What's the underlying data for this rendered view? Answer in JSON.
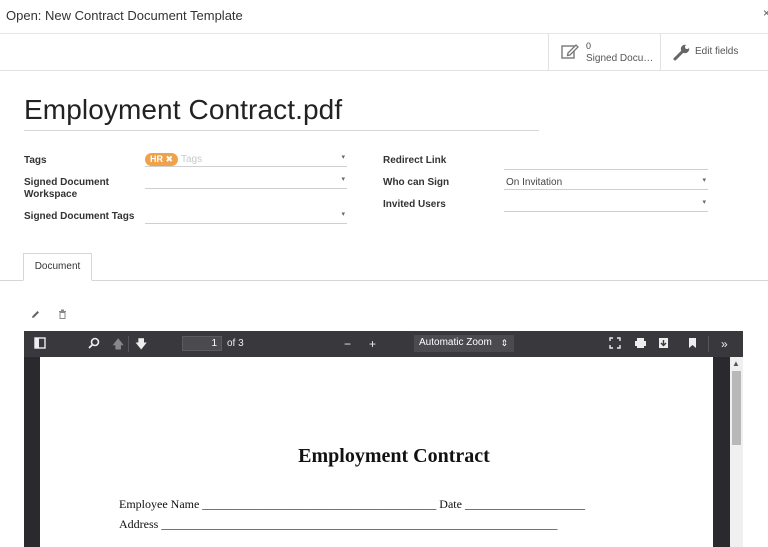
{
  "dialog": {
    "title": "Open: New Contract Document Template",
    "close_glyph": "×"
  },
  "buttonbox": {
    "signed_count": "0",
    "signed_label": "Signed Documents",
    "edit_label": "Edit fields"
  },
  "record": {
    "name": "Employment Contract.pdf"
  },
  "form": {
    "tags_label": "Tags",
    "tags": [
      {
        "label": "HR",
        "color": "#f0a24b"
      }
    ],
    "tags_placeholder": "Tags",
    "workspace_label": "Signed Document Workspace",
    "workspace_value": "",
    "signed_tags_label": "Signed Document Tags",
    "signed_tags_value": "",
    "redirect_label": "Redirect Link",
    "redirect_value": "",
    "who_can_sign_label": "Who can Sign",
    "who_can_sign_value": "On Invitation",
    "invited_users_label": "Invited Users",
    "invited_users_value": ""
  },
  "tabs": [
    {
      "label": "Document",
      "active": true
    }
  ],
  "actions": {
    "edit_icon": "pencil-icon",
    "delete_icon": "trash-icon"
  },
  "viewer": {
    "current_page": "1",
    "page_count": "of 3",
    "zoom": "Automatic Zoom",
    "minus": "−",
    "plus": "+",
    "document": {
      "heading": "Employment Contract",
      "employee_line": "Employee Name _______________________________________ Date ____________________",
      "address_line": "Address __________________________________________________________________"
    }
  }
}
